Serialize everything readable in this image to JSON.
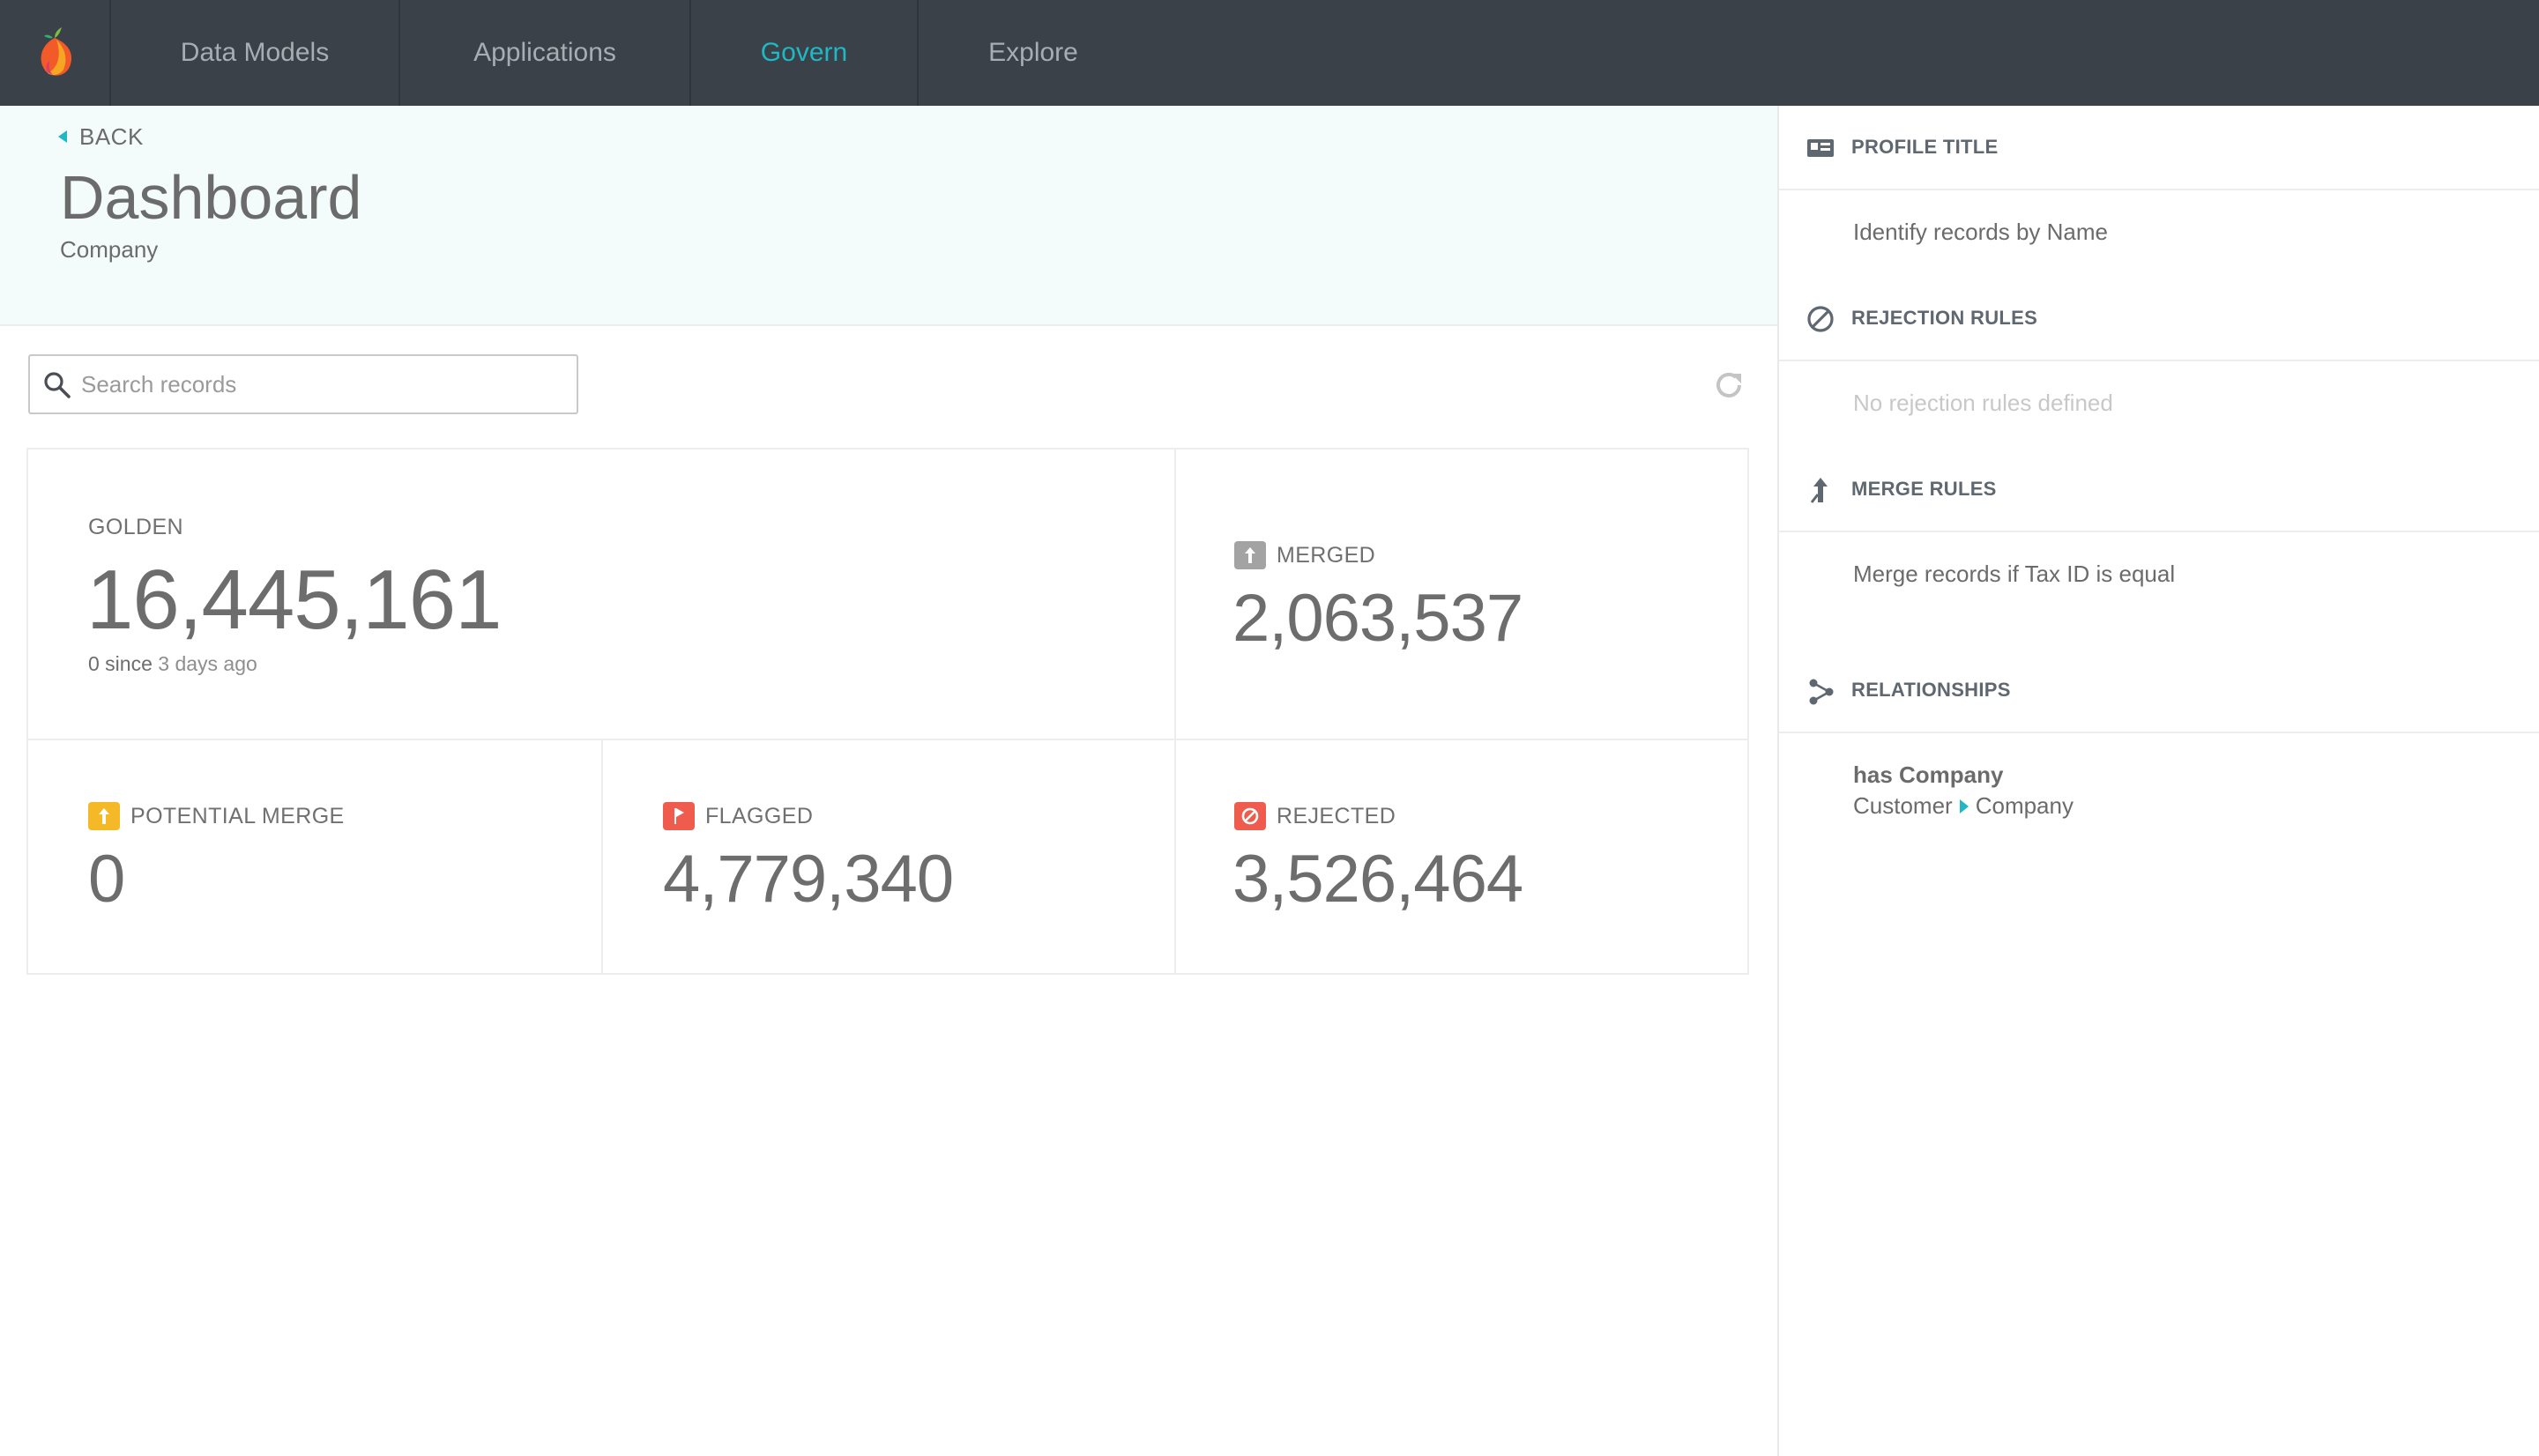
{
  "nav": {
    "tabs": [
      {
        "label": "Data Models"
      },
      {
        "label": "Applications"
      },
      {
        "label": "Govern"
      },
      {
        "label": "Explore"
      }
    ],
    "active_color": "#1fb8c4"
  },
  "header": {
    "back_label": "BACK",
    "title": "Dashboard",
    "subtitle": "Company"
  },
  "search": {
    "placeholder": "Search records"
  },
  "stats": {
    "golden": {
      "label": "GOLDEN",
      "value": "16,445,161",
      "sub_count": "0 since",
      "sub_time": "3 days ago"
    },
    "merged": {
      "label": "MERGED",
      "value": "2,063,537",
      "badge_color": "#9e9e9e",
      "icon": "merge-icon"
    },
    "potential_merge": {
      "label": "POTENTIAL MERGE",
      "value": "0",
      "badge_color": "#f5b927",
      "icon": "merge-icon"
    },
    "flagged": {
      "label": "FLAGGED",
      "value": "4,779,340",
      "badge_color": "#ef5b4c",
      "icon": "flag-icon"
    },
    "rejected": {
      "label": "REJECTED",
      "value": "3,526,464",
      "badge_color": "#ef5b4c",
      "icon": "ban-icon"
    }
  },
  "sidebar": {
    "profile_title": {
      "heading": "PROFILE TITLE",
      "body": "Identify records by Name"
    },
    "rejection_rules": {
      "heading": "REJECTION RULES",
      "body": "No rejection rules defined"
    },
    "merge_rules": {
      "heading": "MERGE RULES",
      "body": "Merge records if Tax ID is equal"
    },
    "relationships": {
      "heading": "RELATIONSHIPS",
      "title": "has Company",
      "from": "Customer",
      "to": "Company"
    }
  }
}
